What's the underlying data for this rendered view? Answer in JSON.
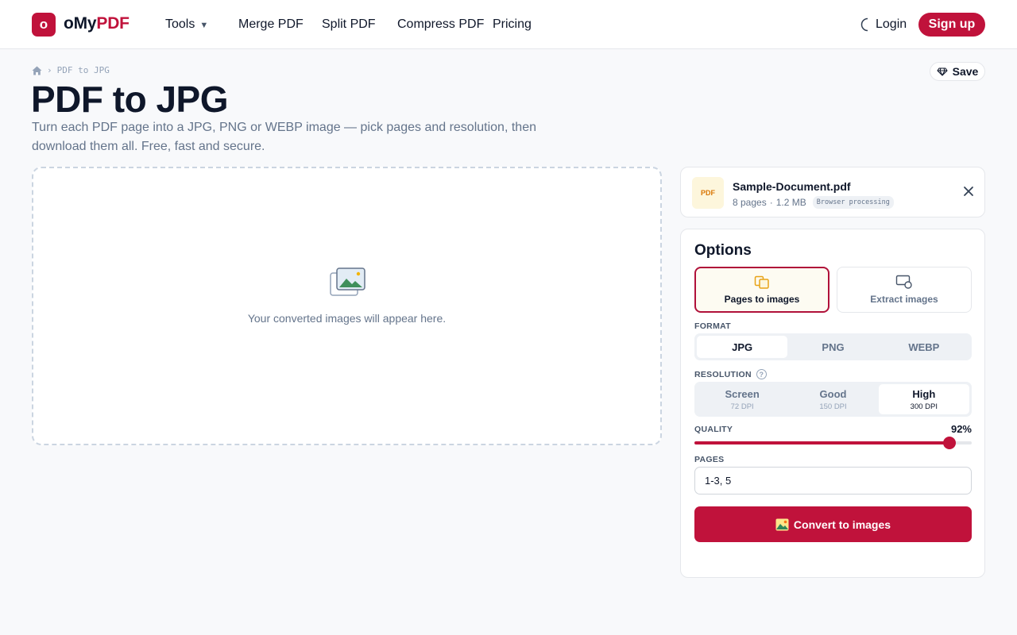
{
  "header": {
    "logo_letter": "o",
    "logo_name_prefix": "oMy",
    "logo_name_accent": "PDF",
    "nav": {
      "tools": "Tools",
      "merge": "Merge PDF",
      "split": "Split PDF",
      "compress": "Compress PDF",
      "pricing": "Pricing"
    },
    "login": "Login",
    "signup": "Sign up"
  },
  "breadcrumb": {
    "current": "PDF to JPG"
  },
  "save_label": "Save",
  "page": {
    "title": "PDF to JPG",
    "description": "Turn each PDF page into a JPG, PNG or WEBP image — pick pages and resolution, then download them all. Free, fast and secure."
  },
  "dropzone": {
    "placeholder": "Your converted images will appear here."
  },
  "file": {
    "thumb_label": "PDF",
    "name": "Sample-Document.pdf",
    "pages": "8 pages",
    "separator": "·",
    "size": "1.2 MB",
    "badge": "Browser processing"
  },
  "options": {
    "title": "Options",
    "modes": [
      {
        "label": "Pages to images",
        "selected": true
      },
      {
        "label": "Extract images",
        "selected": false
      }
    ],
    "format": {
      "label": "FORMAT",
      "options": [
        "JPG",
        "PNG",
        "WEBP"
      ],
      "selected": "JPG"
    },
    "resolution": {
      "label": "RESOLUTION",
      "options": [
        {
          "name": "Screen",
          "dpi": "72 DPI"
        },
        {
          "name": "Good",
          "dpi": "150 DPI"
        },
        {
          "name": "High",
          "dpi": "300 DPI"
        }
      ],
      "selected": "High"
    },
    "quality": {
      "label": "QUALITY",
      "value": 92,
      "display": "92%"
    },
    "pages": {
      "label": "PAGES",
      "value": "1-3, 5"
    },
    "convert_label": "Convert to images"
  },
  "colors": {
    "brand": "#c0123b",
    "background": "#f8f9fb"
  },
  "icons": {
    "theme": "moon-icon",
    "save": "diamond-icon",
    "placeholder": "images-icon",
    "close": "close-icon",
    "mode_pages": "copy-pages-icon",
    "mode_extract": "image-search-icon",
    "convert": "picture-icon"
  }
}
